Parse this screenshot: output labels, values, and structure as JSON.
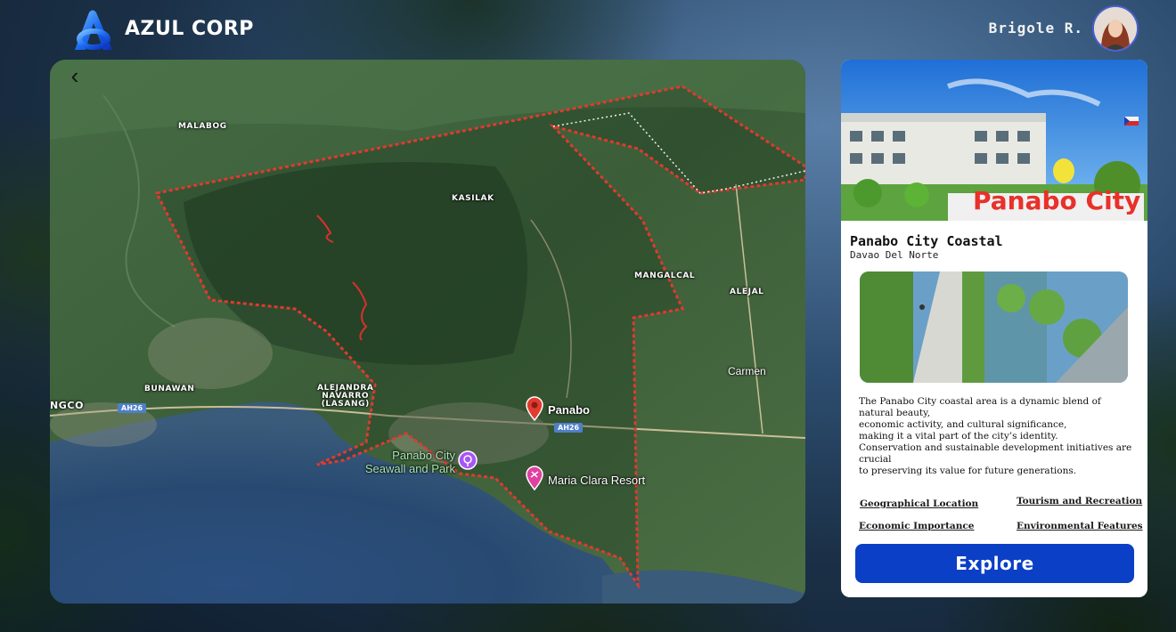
{
  "header": {
    "brand": "AZUL CORP",
    "user_name": "Brigole R."
  },
  "map": {
    "labels": {
      "malabog": "MALABOG",
      "kasilak": "KASILAK",
      "mangalcal": "MANGALCAL",
      "alejal": "ALEJAL",
      "carmen": "Carmen",
      "bunawan": "BUNAWAN",
      "alejandra_line1": "ALEJANDRA",
      "alejandra_line2": "NAVARRO",
      "alejandra_line3": "(LASANG)",
      "ngco": "NGCO"
    },
    "roads": {
      "ah26_left": "AH26",
      "ah26_center": "AH26"
    },
    "places": {
      "panabo": "Panabo",
      "seawall_line1": "Panabo City",
      "seawall_line2": "Seawall and Park",
      "maria_clara": "Maria Clara Resort"
    },
    "icons": {
      "back": "chevron-left-icon",
      "panabo_pin": "location-pin-icon",
      "seawall_pin": "park-pin-icon",
      "resort_pin": "resort-pin-icon"
    }
  },
  "card": {
    "hero_sign": "Panabo City",
    "title": "Panabo City Coastal",
    "subtitle": "Davao Del Norte",
    "description": [
      "The Panabo City coastal area is a dynamic blend of natural beauty,",
      "economic activity, and cultural significance,",
      "making it a vital part of the city’s identity.",
      "Conservation and sustainable development initiatives are crucial",
      "to preserving its value for future generations."
    ],
    "links": {
      "geo": "Geographical Location",
      "tourism": "Tourism and Recreation",
      "economic": "Economic Importance",
      "environment": "Environmental Features"
    },
    "explore_label": "Explore"
  },
  "colors": {
    "accent_blue": "#0b3fc6",
    "boundary_red": "#e03a2f",
    "avatar_ring": "#4a5fd0"
  }
}
